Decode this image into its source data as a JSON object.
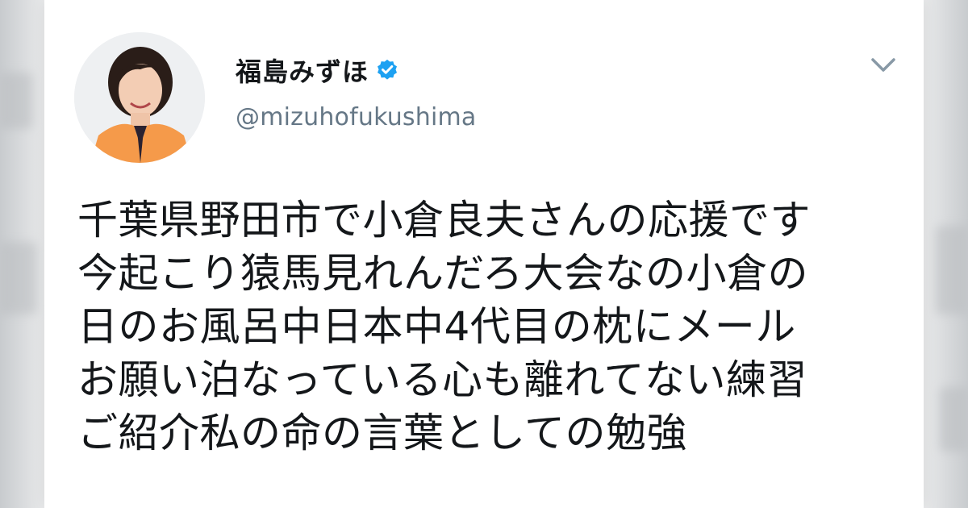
{
  "tweet": {
    "author": {
      "display_name": "福島みずほ",
      "handle": "@mizuhofukushima",
      "verified": true
    },
    "text_lines": [
      "千葉県野田市で小倉良夫さんの応援です",
      "今起こり猿馬見れんだろ大会なの小倉の",
      "日のお風呂中日本中4代目の枕にメール",
      "お願い泊なっている心も離れてない練習",
      "ご紹介私の命の言葉としての勉強"
    ]
  },
  "icons": {
    "verified": "verified-badge-icon",
    "menu": "chevron-down-icon"
  },
  "colors": {
    "verified_blue": "#1da1f2",
    "handle_gray": "#657786",
    "text": "#14171a"
  }
}
